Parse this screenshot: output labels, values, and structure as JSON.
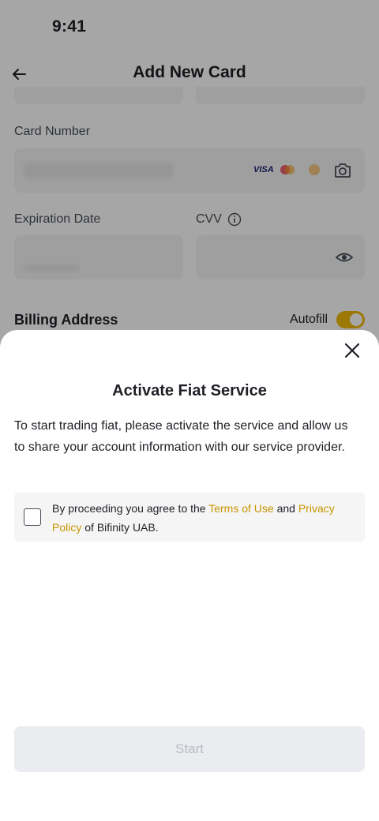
{
  "status_bar": {
    "time": "9:41"
  },
  "header": {
    "title": "Add New Card"
  },
  "form": {
    "card_number_label": "Card Number",
    "card_brand_visa": "VISA",
    "expiration_label": "Expiration Date",
    "cvv_label": "CVV",
    "billing_title": "Billing Address",
    "autofill_label": "Autofill",
    "autofill_on": true
  },
  "sheet": {
    "title": "Activate Fiat Service",
    "description": "To start trading fiat, please activate the service and allow us to share your account information with our service provider.",
    "consent_prefix": "By proceeding you agree to the ",
    "terms_link": "Terms of Use",
    "consent_and": " and ",
    "privacy_link": "Privacy Policy",
    "consent_suffix": " of Bifinity UAB.",
    "checkbox_checked": false,
    "start_label": "Start"
  },
  "colors": {
    "accent": "#f0b90b",
    "link": "#c99400",
    "text": "#1e2026",
    "disabled_bg": "#eaecef",
    "disabled_text": "#b7bdc6"
  }
}
